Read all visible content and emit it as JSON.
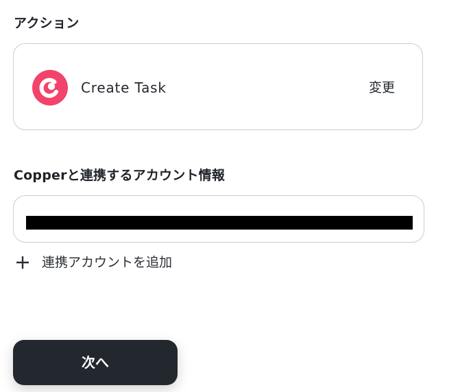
{
  "action_section": {
    "title": "アクション",
    "app_icon": "copper-logo-icon",
    "action_name": "Create Task",
    "change_label": "変更"
  },
  "account_section": {
    "title": "Copperと連携するアカウント情報",
    "add_account_label": "連携アカウントを追加",
    "add_icon": "plus-icon"
  },
  "footer": {
    "next_label": "次へ"
  },
  "colors": {
    "brand_copper": "#f2436b",
    "button_bg": "#23272e",
    "border": "#c9ccd1",
    "redaction": "#000000"
  }
}
